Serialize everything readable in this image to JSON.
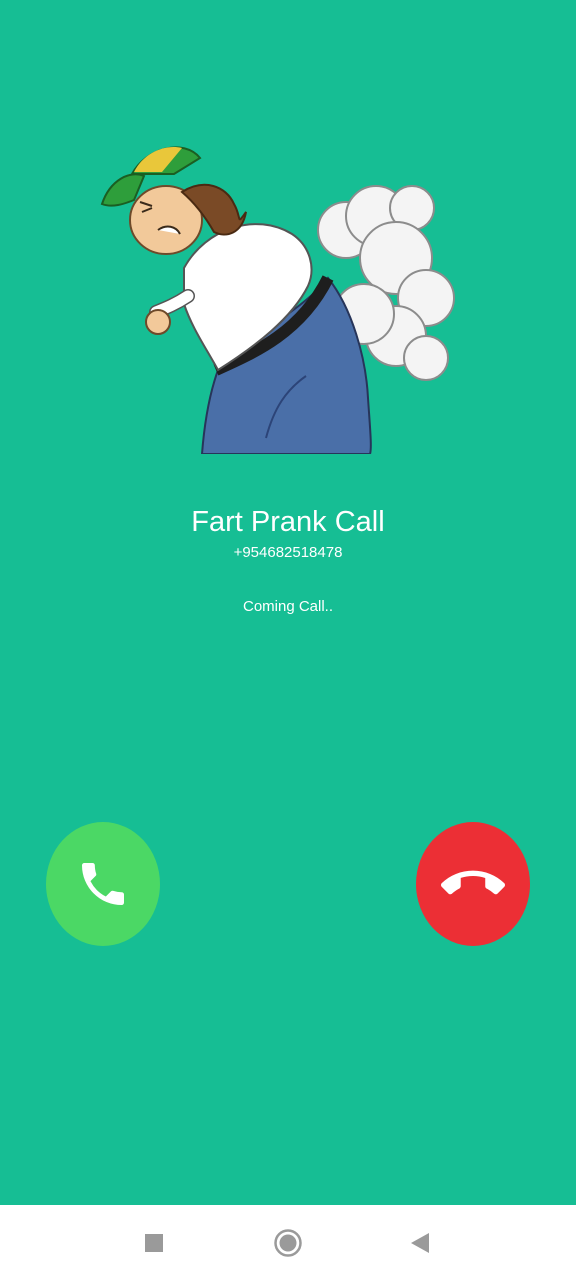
{
  "caller": {
    "name": "Fart Prank Call",
    "number": "+954682518478",
    "status": "Coming Call..",
    "image_icon": "cartoon-boy-fart-illustration"
  },
  "actions": {
    "accept_icon": "phone-icon",
    "decline_icon": "phone-hangup-icon"
  },
  "navigation": {
    "recents_icon": "square-icon",
    "home_icon": "circle-icon",
    "back_icon": "triangle-back-icon"
  },
  "colors": {
    "background": "#16BE94",
    "accept": "#4BD865",
    "decline": "#EC2F35",
    "text": "#FFFFFF",
    "nav_bar": "#FFFFFF",
    "nav_icon": "#9A9A9A"
  }
}
